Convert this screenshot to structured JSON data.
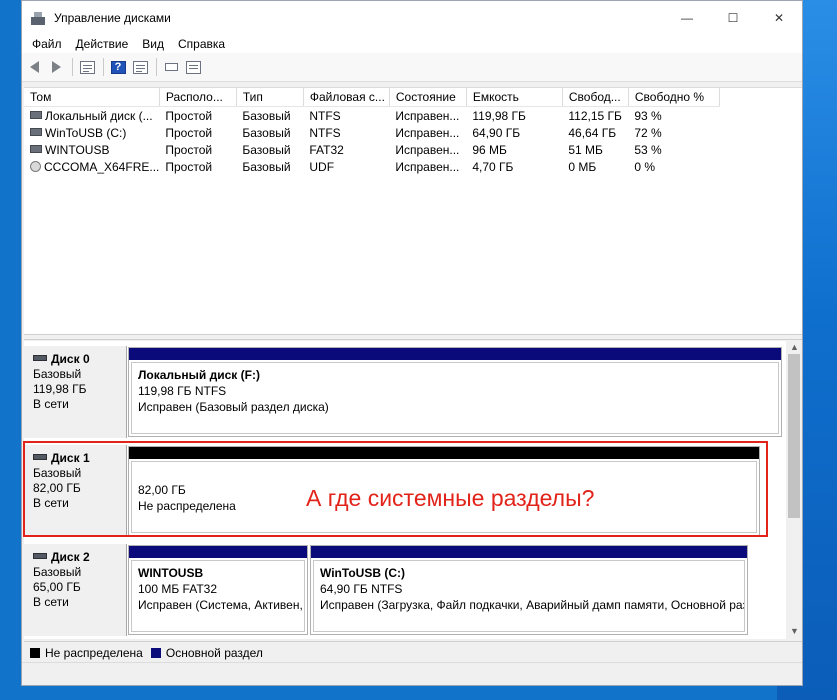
{
  "window": {
    "title": "Управление дисками",
    "min_label": "—",
    "max_label": "☐",
    "close_label": "✕"
  },
  "menu": [
    "Файл",
    "Действие",
    "Вид",
    "Справка"
  ],
  "toolbar": {
    "help_glyph": "?",
    "icons": [
      "back-arrow-icon",
      "forward-arrow-icon",
      "console-tree-icon",
      "help-icon",
      "properties-icon",
      "refresh-icon",
      "list-view-icon"
    ]
  },
  "volumes": {
    "columns": [
      "Том",
      "Располо...",
      "Тип",
      "Файловая с...",
      "Состояние",
      "Емкость",
      "Свобод...",
      "Свободно %"
    ],
    "rows": [
      {
        "icon": "disk",
        "cells": [
          "Локальный диск (...",
          "Простой",
          "Базовый",
          "NTFS",
          "Исправен...",
          "119,98 ГБ",
          "112,15 ГБ",
          "93 %"
        ]
      },
      {
        "icon": "disk",
        "cells": [
          "WinToUSB (C:)",
          "Простой",
          "Базовый",
          "NTFS",
          "Исправен...",
          "64,90 ГБ",
          "46,64 ГБ",
          "72 %"
        ]
      },
      {
        "icon": "disk",
        "cells": [
          "WINTOUSB",
          "Простой",
          "Базовый",
          "FAT32",
          "Исправен...",
          "96 МБ",
          "51 МБ",
          "53 %"
        ]
      },
      {
        "icon": "cd",
        "cells": [
          "CCCOMA_X64FRE...",
          "Простой",
          "Базовый",
          "UDF",
          "Исправен...",
          "4,70 ГБ",
          "0 МБ",
          "0 %"
        ]
      }
    ]
  },
  "disks": [
    {
      "name": "Диск 0",
      "type": "Базовый",
      "size": "119,98 ГБ",
      "status": "В сети",
      "partitions": [
        {
          "bar": "blue",
          "name": "Локальный диск  (F:)",
          "line1": "119,98 ГБ NTFS",
          "line2": "Исправен (Базовый раздел диска)"
        }
      ]
    },
    {
      "name": "Диск 1",
      "type": "Базовый",
      "size": "82,00 ГБ",
      "status": "В сети",
      "partitions": [
        {
          "bar": "black",
          "name": "",
          "line1": "82,00 ГБ",
          "line2": "Не распределена"
        }
      ]
    },
    {
      "name": "Диск 2",
      "type": "Базовый",
      "size": "65,00 ГБ",
      "status": "В сети",
      "partitions": [
        {
          "bar": "blue",
          "name": "WINTOUSB",
          "line1": "100 МБ FAT32",
          "line2": "Исправен (Система, Активен, Г"
        },
        {
          "bar": "blue",
          "name": "WinToUSB  (C:)",
          "line1": "64,90 ГБ NTFS",
          "line2": "Исправен (Загрузка, Файл подкачки, Аварийный дамп памяти, Основной раз"
        }
      ]
    }
  ],
  "annotation": "А где системные разделы?",
  "annotation_color": "#e2231a",
  "legend": [
    {
      "color": "#000000",
      "label": "Не распределена"
    },
    {
      "color": "#0a0a7a",
      "label": "Основной раздел"
    }
  ]
}
